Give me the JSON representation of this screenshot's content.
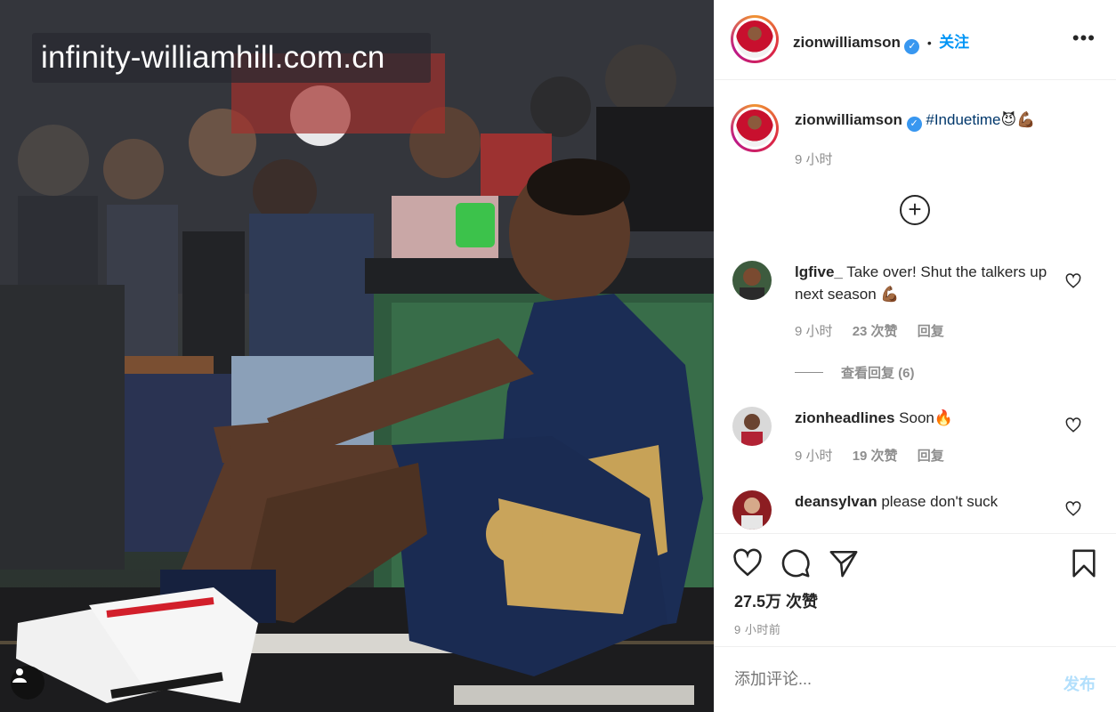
{
  "watermark": "infinity-williamhill.com.cn",
  "post": {
    "username": "zionwilliamson",
    "follow_label": "关注",
    "more_label": "•••",
    "caption": {
      "username": "zionwilliamson",
      "hashtag": "#Induetime",
      "emojis": "😈💪🏾",
      "time": "9 小时"
    },
    "comments": [
      {
        "username": "lgfive_",
        "text": "Take over! Shut the talkers up next season",
        "emoji": "💪🏾",
        "time": "9 小时",
        "likes": "23 次赞",
        "reply_label": "回复",
        "view_replies": "查看回复 (6)"
      },
      {
        "username": "zionheadlines",
        "text": "Soon",
        "emoji": "🔥",
        "time": "9 小时",
        "likes": "19 次赞",
        "reply_label": "回复"
      },
      {
        "username": "deansylvan",
        "text": "please don't suck"
      }
    ],
    "likes_count": "27.5万 次赞",
    "posted_time": "9 小时前",
    "comment_placeholder": "添加评论...",
    "post_button": "发布"
  },
  "colors": {
    "link_blue": "#0095f6",
    "verified_blue": "#3897f0",
    "muted_gray": "#8e8e8e",
    "post_button_disabled": "#b2dffc"
  },
  "icons": [
    "verified-badge-icon",
    "more-options-icon",
    "load-more-comments-icon",
    "heart-icon",
    "comment-icon",
    "share-icon",
    "bookmark-icon",
    "user-tag-icon"
  ]
}
